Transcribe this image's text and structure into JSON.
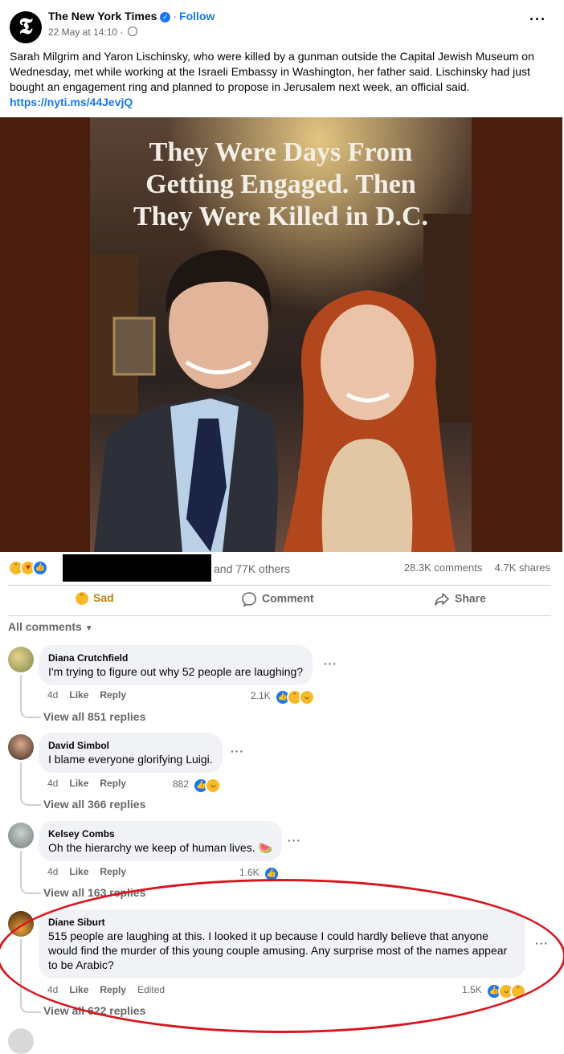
{
  "post": {
    "page_name": "The New York Times",
    "follow": "Follow",
    "date": "22 May at 14:10 ·",
    "text": "Sarah Milgrim and Yaron Lischinsky, who were killed by a gunman outside the Capital Jewish Museum on Wednesday, met while working at the Israeli Embassy in Washington, her father said. Lischinsky had just bought an engagement ring and planned to propose in Jerusalem next week, an official said.",
    "link": "https://nyti.ms/44JevjQ",
    "image_title_lines": [
      "They Were Days From",
      "Getting Engaged. Then",
      "They Were Killed in D.C."
    ]
  },
  "stats": {
    "others": "and 77K others",
    "comments": "28.3K comments",
    "shares": "4.7K shares"
  },
  "actions": {
    "sad": "Sad",
    "comment": "Comment",
    "share": "Share"
  },
  "comments_filter": "All comments",
  "comments": [
    {
      "name": "Diana Crutchfield",
      "text": "I'm trying to figure out why 52 people are laughing?",
      "time": "4d",
      "like": "Like",
      "reply": "Reply",
      "reactions": "2.1K",
      "view": "View all 851 replies"
    },
    {
      "name": "David Simbol",
      "text": "I blame everyone glorifying Luigi.",
      "time": "4d",
      "like": "Like",
      "reply": "Reply",
      "reactions": "882",
      "view": "View all 366 replies"
    },
    {
      "name": "Kelsey Combs",
      "text": "Oh the hierarchy we keep of human lives. 🍉",
      "time": "4d",
      "like": "Like",
      "reply": "Reply",
      "reactions": "1.6K",
      "view": "View all 163 replies"
    },
    {
      "name": "Diane Siburt",
      "text": "515 people are laughing at this. I looked it up because I could hardly believe that anyone would find the murder of this young couple amusing. Any surprise most of the names appear to be Arabic?",
      "time": "4d",
      "like": "Like",
      "reply": "Reply",
      "edited": "Edited",
      "reactions": "1.5K",
      "view": "View all 622 replies"
    }
  ],
  "colors": {
    "accent": "#1877f2",
    "highlight_circle": "#d9161e",
    "image_frame": "#4a1e0c"
  }
}
